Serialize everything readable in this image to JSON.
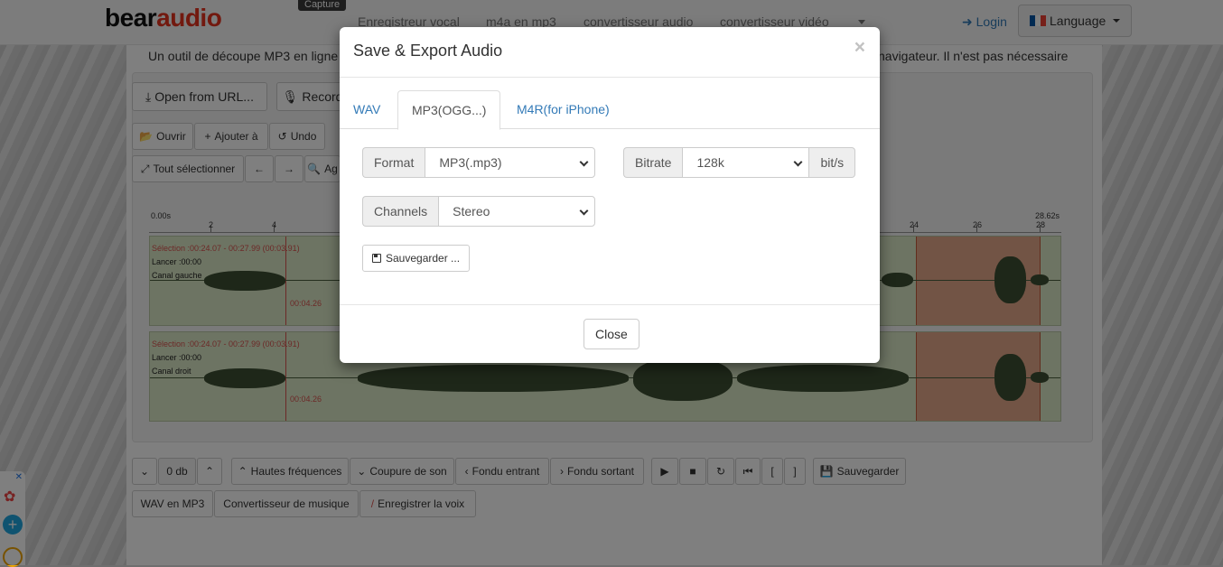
{
  "site": {
    "logo_part1": "bear",
    "logo_part2": "audio",
    "capture_tag": "Capture",
    "nav": [
      "Enregistreur vocal",
      "m4a en mp3",
      "convertisseur audio",
      "convertisseur vidéo"
    ],
    "login": "Login",
    "language": "Language"
  },
  "intro": {
    "left": "Un outil de découpe MP3 en ligne",
    "right": "navigateur. Il n'est pas nécessaire"
  },
  "toolbar": {
    "open_url": "Open from URL...",
    "record": "Record",
    "ouvrir": "Ouvrir",
    "ajouter": "Ajouter à",
    "undo": "Undo",
    "select_all": "Tout sélectionner",
    "zoom_partial": "Ag"
  },
  "ruler": {
    "start": "0.00s",
    "end": "28.62s",
    "ticks": [
      "2",
      "4",
      "24",
      "26",
      "28"
    ]
  },
  "tracks": [
    {
      "selection": "Sélection :00:24.07 - 00:27.99 (00:03.91)",
      "lancer": "Lancer :00:00",
      "channel": "Canal gauche",
      "cursor_time": "00:04.26"
    },
    {
      "selection": "Sélection :00:24.07 - 00:27.99 (00:03.91)",
      "lancer": "Lancer :00:00",
      "channel": "Canal droit",
      "cursor_time": "00:04.26"
    }
  ],
  "bottom_toolbar": {
    "gain": "0 db",
    "high_freq": "Hautes fréquences",
    "cut": "Coupure de son",
    "fade_in": "Fondu entrant",
    "fade_out": "Fondu sortant",
    "bracket_open": "[",
    "bracket_close": "]",
    "save": "Sauvegarder",
    "wav_mp3": "WAV en MP3",
    "music_converter": "Convertisseur de musique",
    "record_voice": "Enregistrer la voix"
  },
  "modal": {
    "title": "Save & Export Audio",
    "close_x": "×",
    "tabs": [
      {
        "label": "WAV",
        "active": false
      },
      {
        "label": "MP3(OGG...)",
        "active": true
      },
      {
        "label": "M4R(for iPhone)",
        "active": false
      }
    ],
    "format_label": "Format",
    "format_value": "MP3(.mp3)",
    "bitrate_label": "Bitrate",
    "bitrate_value": "128k",
    "bitrate_unit": "bit/s",
    "channels_label": "Channels",
    "channels_value": "Stereo",
    "save_button": "Sauvegarder ...",
    "close_button": "Close"
  },
  "colors": {
    "accent_link": "#337ab7",
    "brand_red": "#e4321e",
    "selection_red": "#d9534f",
    "wave_green": "#dbe8c6"
  }
}
